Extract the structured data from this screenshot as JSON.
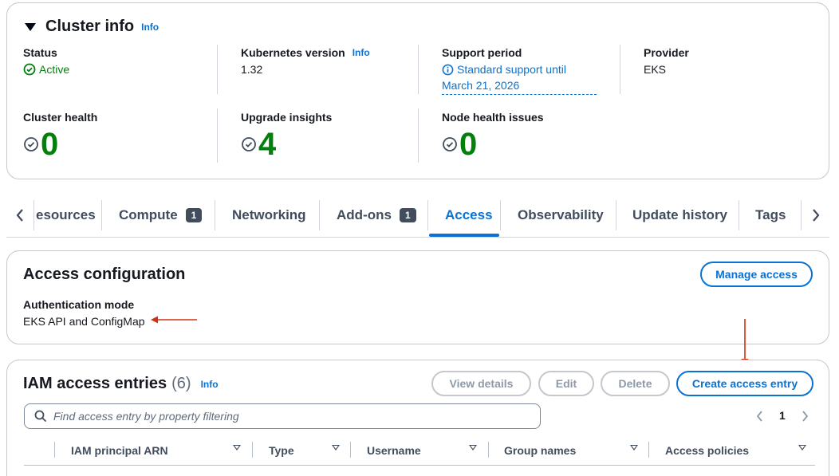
{
  "cluster_info": {
    "title": "Cluster info",
    "info_link": "Info",
    "status": {
      "label": "Status",
      "value": "Active"
    },
    "kubernetes_version": {
      "label": "Kubernetes version",
      "info_link": "Info",
      "value": "1.32"
    },
    "support_period": {
      "label": "Support period",
      "line1": "Standard support until",
      "line2": "March 21, 2026"
    },
    "provider": {
      "label": "Provider",
      "value": "EKS"
    },
    "cluster_health": {
      "label": "Cluster health",
      "value": "0"
    },
    "upgrade_insights": {
      "label": "Upgrade insights",
      "value": "4"
    },
    "node_health_issues": {
      "label": "Node health issues",
      "value": "0"
    }
  },
  "tabs": [
    {
      "label": "esources"
    },
    {
      "label": "Compute",
      "badge": "1"
    },
    {
      "label": "Networking"
    },
    {
      "label": "Add-ons",
      "badge": "1"
    },
    {
      "label": "Access",
      "active": true
    },
    {
      "label": "Observability"
    },
    {
      "label": "Update history"
    },
    {
      "label": "Tags"
    }
  ],
  "access_config": {
    "title": "Access configuration",
    "manage_button": "Manage access",
    "auth_mode_label": "Authentication mode",
    "auth_mode_value": "EKS API and ConfigMap"
  },
  "iam_entries": {
    "title": "IAM access entries",
    "count": "(6)",
    "info_link": "Info",
    "buttons": {
      "view_details": "View details",
      "edit": "Edit",
      "delete": "Delete",
      "create": "Create access entry"
    },
    "search_placeholder": "Find access entry by property filtering",
    "page": "1",
    "columns": [
      "IAM principal ARN",
      "Type",
      "Username",
      "Group names",
      "Access policies"
    ]
  },
  "colors": {
    "accent": "#0972d3",
    "success": "#037f0c",
    "annotation": "#d13212"
  }
}
